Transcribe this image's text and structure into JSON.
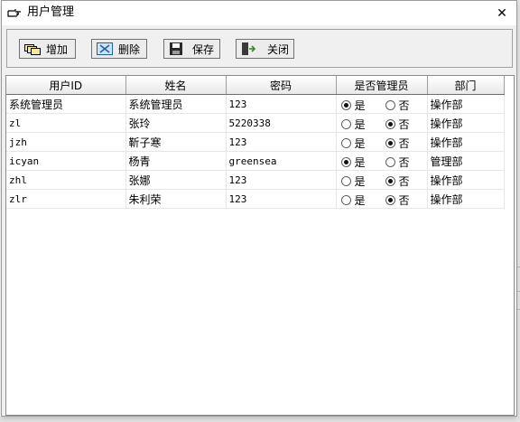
{
  "window": {
    "title": "用户管理",
    "close_symbol": "✕"
  },
  "toolbar": {
    "add_label": "增加",
    "delete_label": "删除",
    "save_label": "保存",
    "close_label": "关闭"
  },
  "table": {
    "columns": [
      "用户ID",
      "姓名",
      "密码",
      "是否管理员",
      "部门"
    ],
    "admin_options": [
      "是",
      "否"
    ],
    "rows": [
      {
        "user_id": "系统管理员",
        "name": "系统管理员",
        "password": "123",
        "is_admin": true,
        "dept": "操作部"
      },
      {
        "user_id": "zl",
        "name": "张玲",
        "password": "5220338",
        "is_admin": false,
        "dept": "操作部"
      },
      {
        "user_id": "jzh",
        "name": "靳子寒",
        "password": "123",
        "is_admin": false,
        "dept": "操作部"
      },
      {
        "user_id": "icyan",
        "name": "杨青",
        "password": "greensea",
        "is_admin": true,
        "dept": "管理部"
      },
      {
        "user_id": "zhl",
        "name": "张娜",
        "password": "123",
        "is_admin": false,
        "dept": "操作部"
      },
      {
        "user_id": "zlr",
        "name": "朱利荣",
        "password": "123",
        "is_admin": false,
        "dept": "操作部"
      }
    ]
  }
}
